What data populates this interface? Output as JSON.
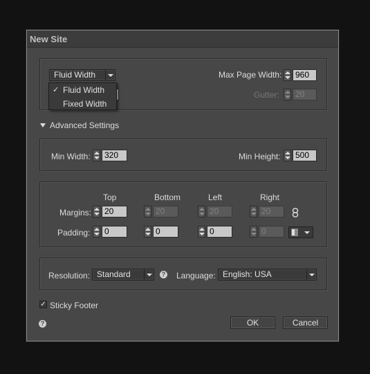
{
  "dialog": {
    "title": "New Site"
  },
  "layout": {
    "layout_select": "Fluid Width",
    "menu_items": [
      "Fluid Width",
      "Fixed Width"
    ],
    "checked_index": 0,
    "max_page_width_label": "Max Page Width:",
    "max_page_width": "960",
    "gutter_label": "Gutter:",
    "gutter": "20"
  },
  "advanced": {
    "label": "Advanced Settings",
    "min_width_label": "Min Width:",
    "min_width": "320",
    "min_height_label": "Min Height:",
    "min_height": "500"
  },
  "spacing": {
    "col_top": "Top",
    "col_bottom": "Bottom",
    "col_left": "Left",
    "col_right": "Right",
    "margins_label": "Margins:",
    "margins": [
      "20",
      "20",
      "20",
      "20"
    ],
    "padding_label": "Padding:",
    "padding": [
      "0",
      "0",
      "0",
      "0"
    ]
  },
  "resolution": {
    "label": "Resolution:",
    "value": "Standard",
    "language_label": "Language:",
    "language": "English: USA"
  },
  "footer": {
    "sticky_label": "Sticky Footer",
    "sticky_checked": true,
    "ok_label": "OK",
    "cancel_label": "Cancel"
  },
  "colors": {
    "dialog_bg": "#474747",
    "field_bg": "#c8c8c8",
    "frame_border": "#8a8a8a"
  }
}
